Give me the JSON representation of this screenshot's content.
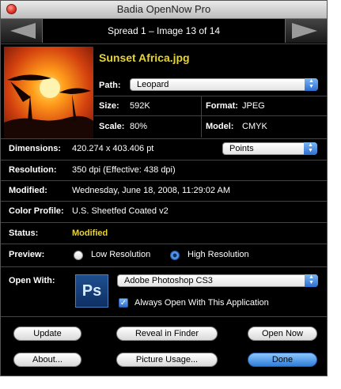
{
  "window": {
    "title": "Badia OpenNow Pro"
  },
  "nav": {
    "position_text": "Spread 1 – Image 13 of 14",
    "prev_icon": "arrow-left-icon",
    "next_icon": "arrow-right-icon"
  },
  "file": {
    "name": "Sunset Africa.jpg",
    "path_label": "Path:",
    "path_value": "Leopard",
    "size_label": "Size:",
    "size_value": "592K",
    "format_label": "Format:",
    "format_value": "JPEG",
    "scale_label": "Scale:",
    "scale_value": "80%",
    "model_label": "Model:",
    "model_value": "CMYK"
  },
  "details": {
    "dimensions_label": "Dimensions:",
    "dimensions_value": "420.274 x 403.406 pt",
    "units_value": "Points",
    "resolution_label": "Resolution:",
    "resolution_value": "350 dpi (Effective: 438 dpi)",
    "modified_label": "Modified:",
    "modified_value": "Wednesday, June 18, 2008, 11:29:02 AM",
    "profile_label": "Color Profile:",
    "profile_value": "U.S. Sheetfed Coated v2",
    "status_label": "Status:",
    "status_value": "Modified",
    "preview_label": "Preview:",
    "preview_low": "Low Resolution",
    "preview_high": "High Resolution",
    "open_with_label": "Open With:",
    "app_value": "Adobe Photoshop CS3",
    "always_open_label": "Always Open With This Application",
    "app_icon_text": "Ps"
  },
  "buttons": {
    "update": "Update",
    "reveal": "Reveal in Finder",
    "open_now": "Open Now",
    "about": "About...",
    "picture_usage": "Picture Usage...",
    "done": "Done"
  },
  "colors": {
    "highlight": "#e8d437",
    "accent": "#2f7ed9"
  }
}
